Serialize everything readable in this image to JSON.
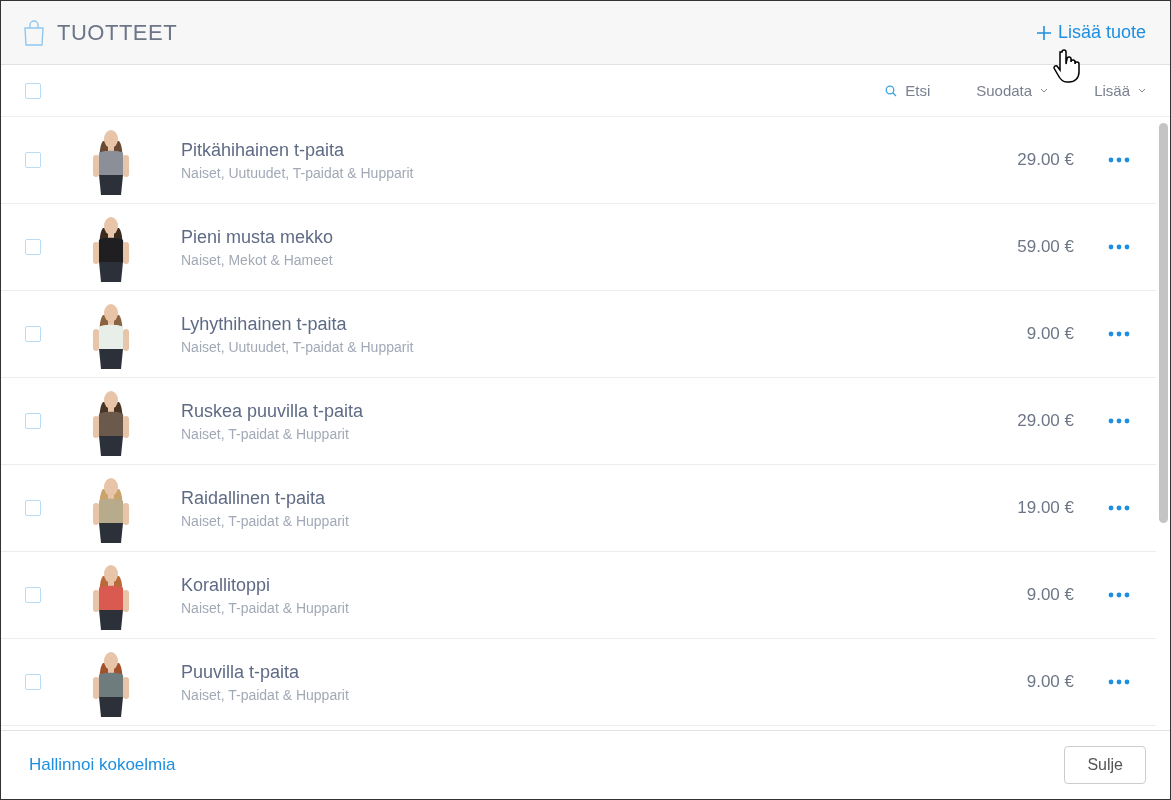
{
  "header": {
    "title": "TUOTTEET",
    "add_button": "Lisää tuote"
  },
  "toolbar": {
    "select_all_checked": false,
    "search": "Etsi",
    "filter": "Suodata",
    "more": "Lisää"
  },
  "products": [
    {
      "name": "Pitkähihainen t-paita",
      "categories": "Naiset, Uutuudet, T-paidat & Hupparit",
      "price": "29.00 €",
      "checked": false
    },
    {
      "name": "Pieni musta mekko",
      "categories": "Naiset, Mekot & Hameet",
      "price": "59.00 €",
      "checked": false
    },
    {
      "name": "Lyhythihainen t-paita",
      "categories": "Naiset, Uutuudet, T-paidat & Hupparit",
      "price": "9.00 €",
      "checked": false
    },
    {
      "name": "Ruskea puuvilla t-paita",
      "categories": "Naiset, T-paidat & Hupparit",
      "price": "29.00 €",
      "checked": false
    },
    {
      "name": "Raidallinen t-paita",
      "categories": "Naiset, T-paidat & Hupparit",
      "price": "19.00 €",
      "checked": false
    },
    {
      "name": "Korallitoppi",
      "categories": "Naiset, T-paidat & Hupparit",
      "price": "9.00 €",
      "checked": false
    },
    {
      "name": "Puuvilla t-paita",
      "categories": "Naiset, T-paidat & Hupparit",
      "price": "9.00 €",
      "checked": false
    }
  ],
  "footer": {
    "link": "Hallinnoi kokoelmia",
    "close_button": "Sulje"
  }
}
